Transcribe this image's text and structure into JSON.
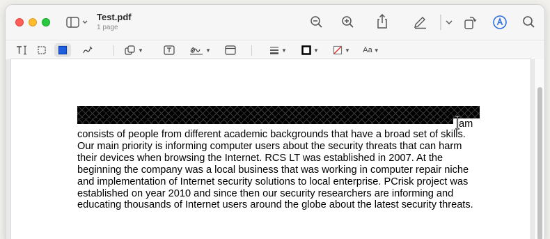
{
  "window": {
    "title": "Test.pdf",
    "subtitle": "1 page"
  },
  "toolbar": {
    "left": [
      "sidebar-toggle"
    ],
    "right": [
      "zoom-out",
      "zoom-in",
      "share",
      "highlight",
      "highlight-options",
      "rotate",
      "markup"
    ]
  },
  "markup_toolbar": {
    "tools": [
      "text-selection",
      "rectangular-selection",
      "redact",
      "sketch",
      "shapes",
      "text",
      "sign",
      "note",
      "shape-style",
      "border-color",
      "fill-color",
      "text-style"
    ],
    "text_style_label": "Aa"
  },
  "document": {
    "visible_fragment": "am",
    "lines": [
      "consists of people from different academic backgrounds that have a broad set of skills.",
      "Our main priority is informing computer users about the security threats that can harm",
      "their devices when browsing the Internet. RCS LT was established in 2007. At the",
      "beginning the company was a local business that was working in computer repair niche",
      "and implementation of Internet security solutions to local enterprise. PCrisk project was",
      "established on year 2010 and since then our security researchers are informing and",
      "educating thousands of Internet users around the globe about the latest security threats."
    ]
  }
}
